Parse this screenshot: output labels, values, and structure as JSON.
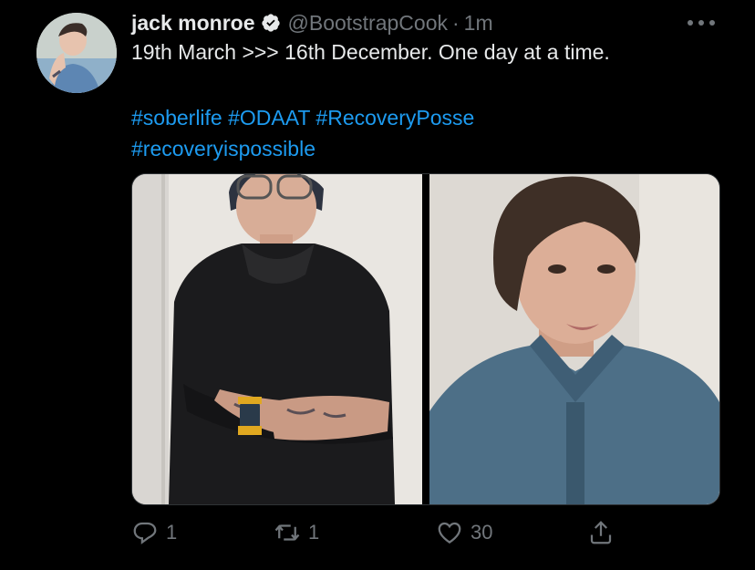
{
  "author": {
    "name": "jack monroe",
    "handle": "@BootstrapCook",
    "separator": "·",
    "time": "1m"
  },
  "tweet": {
    "text": "19th March >>> 16th December. One day at a time.",
    "hashtags": [
      "#soberlife",
      "#ODAAT",
      "#RecoveryPosse",
      "#recoveryispossible"
    ]
  },
  "stats": {
    "replies": "1",
    "retweets": "1",
    "likes": "30"
  },
  "colors": {
    "background": "#000000",
    "text": "#e7e9ea",
    "muted": "#71767b",
    "link": "#1d9bf0"
  },
  "icons": [
    "verified-badge-icon",
    "more-icon",
    "reply-icon",
    "retweet-icon",
    "like-icon",
    "share-icon"
  ]
}
